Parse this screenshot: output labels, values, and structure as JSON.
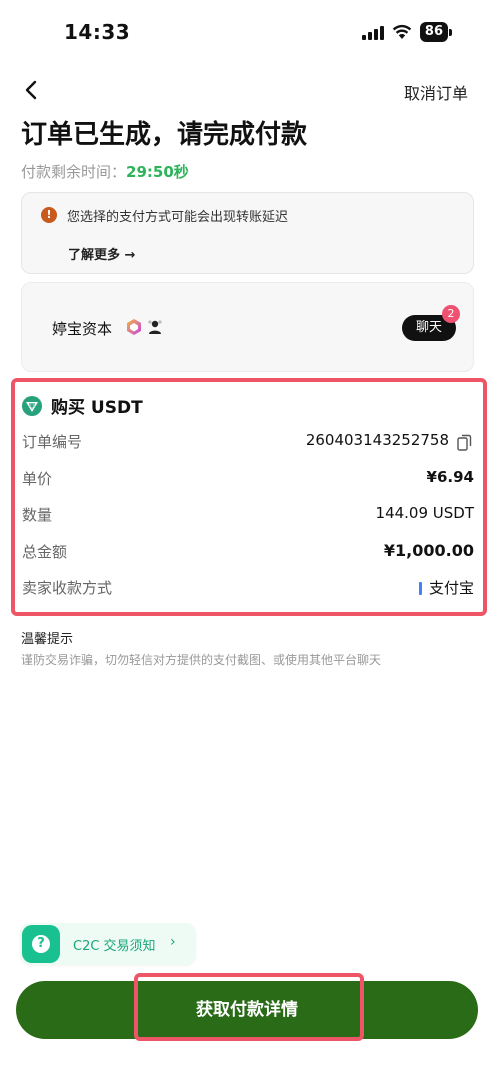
{
  "status_bar": {
    "time": "14:33",
    "battery": "86"
  },
  "header": {
    "cancel_label": "取消订单",
    "title": "订单已生成，请完成付款",
    "timer_label": "付款剩余时间：",
    "timer_value": "29:50秒"
  },
  "notice": {
    "text": "您选择的支付方式可能会出现转账延迟",
    "learn_more": "了解更多 →"
  },
  "merchant": {
    "name": "婷宝资本",
    "chat_label": "聊天",
    "unread_count": "2"
  },
  "order": {
    "title": "购买 USDT",
    "rows": [
      {
        "label": "订单编号",
        "value": "260403143252758"
      },
      {
        "label": "单价",
        "value": "¥6.94"
      },
      {
        "label": "数量",
        "value": "144.09 USDT"
      },
      {
        "label": "总金额",
        "value": "¥1,000.00"
      },
      {
        "label": "卖家收款方式",
        "value": "支付宝"
      }
    ]
  },
  "tips": {
    "title": "温馨提示",
    "text": "谨防交易诈骗，切勿轻信对方提供的支付截图、或使用其他平台聊天"
  },
  "c2c": {
    "label": "C2C 交易须知",
    "chevron": "›"
  },
  "pay_button": {
    "label": "获取付款详情"
  },
  "colors": {
    "accent_green": "#2a6b17",
    "timer_green": "#2db35a",
    "highlight_red": "#ee5567",
    "alipay_blue": "#3f82f5"
  }
}
